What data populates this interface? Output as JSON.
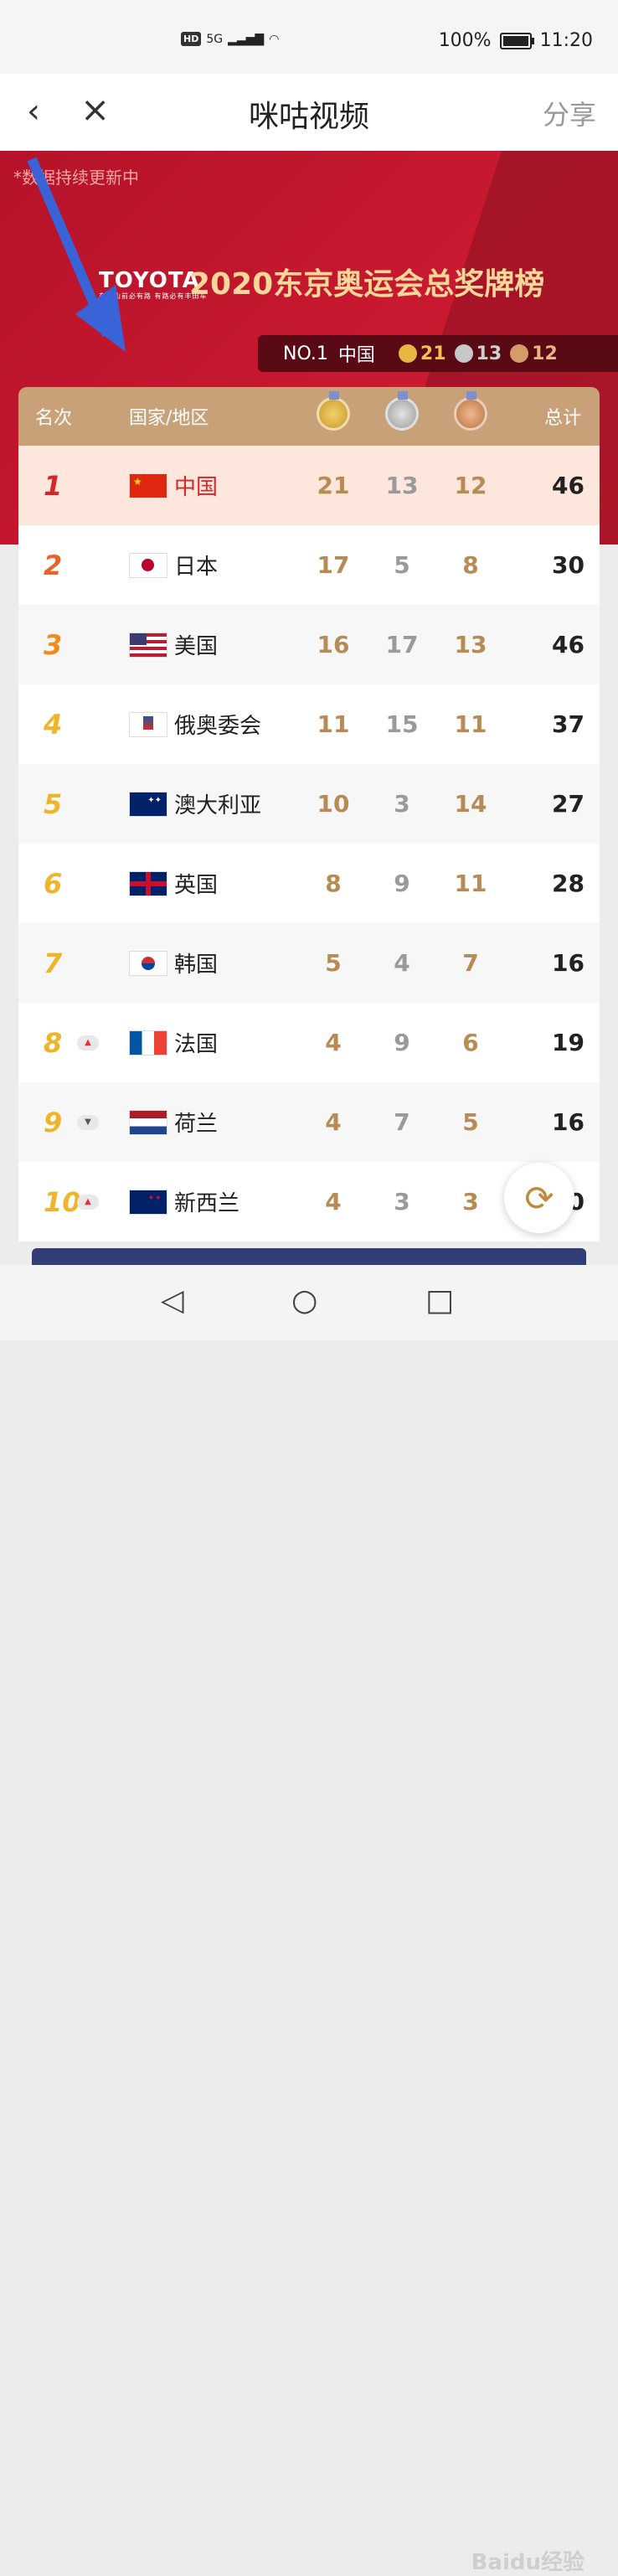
{
  "status_bar": {
    "hd": "HD",
    "network": "5G",
    "battery": "100%",
    "time": "11:20"
  },
  "nav": {
    "title": "咪咕视频",
    "share": "分享"
  },
  "hero": {
    "note": "*数据持续更新中",
    "brand": "TOYOTA",
    "slogan": "车到山前必有路  有路必有丰田车",
    "headline": "2020东京奥运会总奖牌榜"
  },
  "topbar": {
    "rank": "NO.1",
    "country": "中国",
    "gold": "21",
    "silver": "13",
    "bronze": "12"
  },
  "table": {
    "headers": {
      "rank": "名次",
      "country": "国家/地区",
      "total": "总计"
    },
    "rows": [
      {
        "rank": "1",
        "country": "中国",
        "gold": "21",
        "silver": "13",
        "bronze": "12",
        "total": "46",
        "trend": ""
      },
      {
        "rank": "2",
        "country": "日本",
        "gold": "17",
        "silver": "5",
        "bronze": "8",
        "total": "30",
        "trend": ""
      },
      {
        "rank": "3",
        "country": "美国",
        "gold": "16",
        "silver": "17",
        "bronze": "13",
        "total": "46",
        "trend": ""
      },
      {
        "rank": "4",
        "country": "俄奥委会",
        "gold": "11",
        "silver": "15",
        "bronze": "11",
        "total": "37",
        "trend": ""
      },
      {
        "rank": "5",
        "country": "澳大利亚",
        "gold": "10",
        "silver": "3",
        "bronze": "14",
        "total": "27",
        "trend": ""
      },
      {
        "rank": "6",
        "country": "英国",
        "gold": "8",
        "silver": "9",
        "bronze": "11",
        "total": "28",
        "trend": ""
      },
      {
        "rank": "7",
        "country": "韩国",
        "gold": "5",
        "silver": "4",
        "bronze": "7",
        "total": "16",
        "trend": ""
      },
      {
        "rank": "8",
        "country": "法国",
        "gold": "4",
        "silver": "9",
        "bronze": "6",
        "total": "19",
        "trend": "up"
      },
      {
        "rank": "9",
        "country": "荷兰",
        "gold": "4",
        "silver": "7",
        "bronze": "5",
        "total": "16",
        "trend": "down"
      },
      {
        "rank": "10",
        "country": "新西兰",
        "gold": "4",
        "silver": "3",
        "bronze": "3",
        "total": "10",
        "trend": "up"
      }
    ]
  },
  "watermark": "Baidu经验",
  "colors": {
    "accent_gold": "#c9a178",
    "hero_red": "#c4182e",
    "rank1": "#d6262b"
  }
}
